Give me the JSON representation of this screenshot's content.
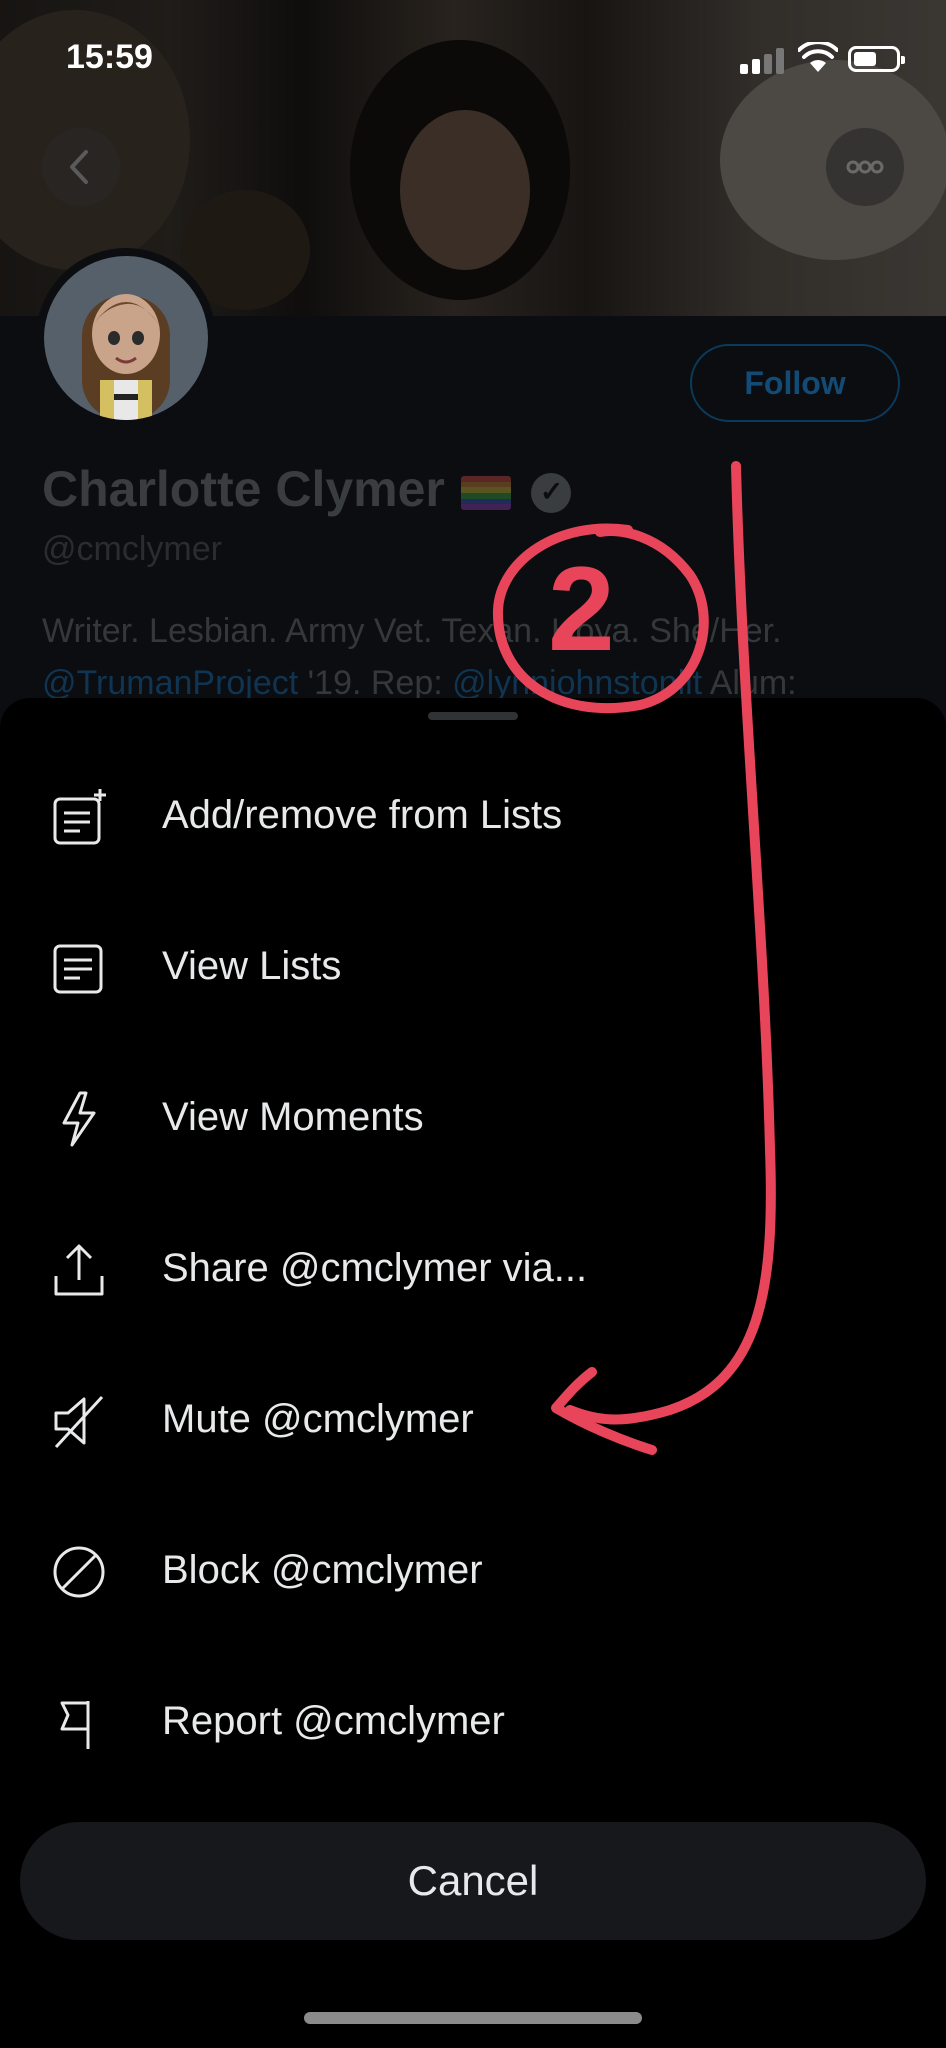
{
  "status_bar": {
    "time": "15:59"
  },
  "profile": {
    "follow_label": "Follow",
    "display_name": "Charlotte Clymer",
    "handle": "@cmclymer",
    "bio_line1": "Writer. Lesbian. Army Vet. Texan. Hoya. She/Her.",
    "bio_line2_link1": "@TrumanProject",
    "bio_line2_text1": " '19. Rep: ",
    "bio_line2_link2": "@lynnjohnstonlit",
    "bio_line2_text2": " Alum:"
  },
  "menu": {
    "items": [
      {
        "label": "Add/remove from Lists",
        "icon": "list-add-icon"
      },
      {
        "label": "View Lists",
        "icon": "list-icon"
      },
      {
        "label": "View Moments",
        "icon": "lightning-icon"
      },
      {
        "label": "Share @cmclymer via...",
        "icon": "share-icon"
      },
      {
        "label": "Mute @cmclymer",
        "icon": "mute-icon"
      },
      {
        "label": "Block @cmclymer",
        "icon": "block-icon"
      },
      {
        "label": "Report @cmclymer",
        "icon": "flag-icon"
      }
    ],
    "cancel_label": "Cancel"
  },
  "annotation": {
    "number": "2",
    "color": "#e8455a"
  }
}
